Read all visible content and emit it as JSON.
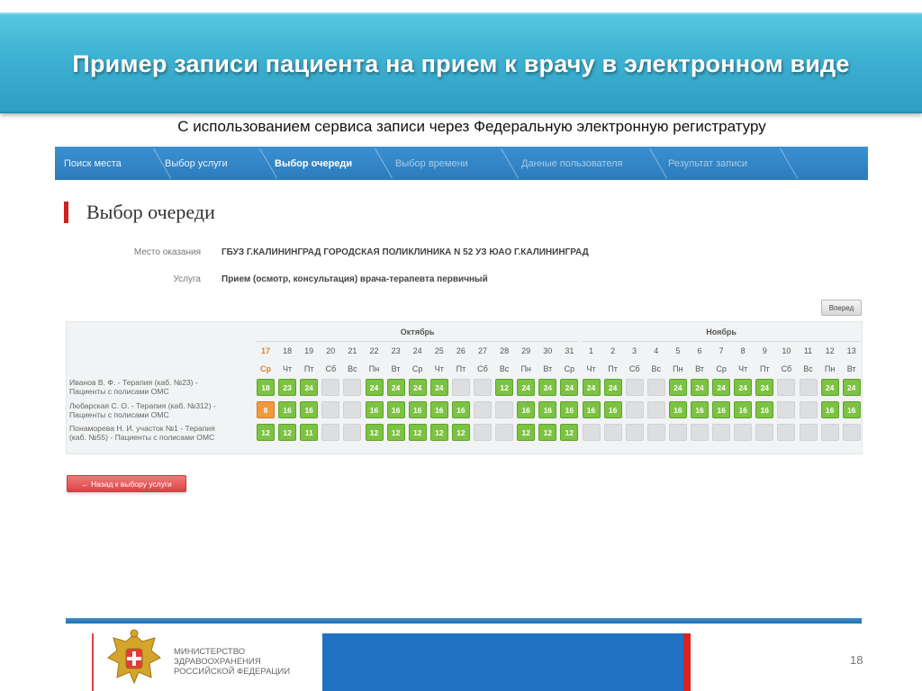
{
  "slide": {
    "title": "Пример записи пациента на прием к врачу в электронном виде",
    "subtitle": "С использованием сервиса записи через Федеральную электронную регистратуру",
    "page_number": "18",
    "ministry": [
      "МИНИСТЕРСТВО",
      "ЗДРАВООХРАНЕНИЯ",
      "РОССИЙСКОЙ ФЕДЕРАЦИИ"
    ],
    "colors": {
      "banner": "#3fb3d3",
      "steps": "#2f80c0",
      "slot_available": "#7cc243",
      "slot_today": "#ef9a3c",
      "slot_empty": "#dcdedf"
    }
  },
  "steps": [
    {
      "label": "Поиск места",
      "state": "done"
    },
    {
      "label": "Выбор услуги",
      "state": "done"
    },
    {
      "label": "Выбор очереди",
      "state": "active"
    },
    {
      "label": "Выбор времени",
      "state": "pending"
    },
    {
      "label": "Данные пользователя",
      "state": "pending"
    },
    {
      "label": "Результат записи",
      "state": "pending"
    }
  ],
  "page": {
    "heading": "Выбор очереди",
    "place_label": "Место оказания",
    "place_value": "ГБУЗ Г.КАЛИНИНГРАД ГОРОДСКАЯ ПОЛИКЛИНИКА N 52 УЗ ЮАО Г.КАЛИНИНГРАД",
    "service_label": "Услуга",
    "service_value": "Прием (осмотр, консультация) врача-терапевта первичный",
    "next_button": "Вперед",
    "back_button": "← Назад к выбору услуги"
  },
  "schedule": {
    "months": [
      {
        "name": "Октябрь",
        "start": 0,
        "end": 14
      },
      {
        "name": "Ноябрь",
        "start": 15,
        "end": 27
      }
    ],
    "days": [
      {
        "num": "17",
        "dow": "Ср",
        "today": true
      },
      {
        "num": "18",
        "dow": "Чт"
      },
      {
        "num": "19",
        "dow": "Пт"
      },
      {
        "num": "20",
        "dow": "Сб"
      },
      {
        "num": "21",
        "dow": "Вс"
      },
      {
        "num": "22",
        "dow": "Пн"
      },
      {
        "num": "23",
        "dow": "Вт"
      },
      {
        "num": "24",
        "dow": "Ср"
      },
      {
        "num": "25",
        "dow": "Чт"
      },
      {
        "num": "26",
        "dow": "Пт"
      },
      {
        "num": "27",
        "dow": "Сб"
      },
      {
        "num": "28",
        "dow": "Вс"
      },
      {
        "num": "29",
        "dow": "Пн"
      },
      {
        "num": "30",
        "dow": "Вт"
      },
      {
        "num": "31",
        "dow": "Ср"
      },
      {
        "num": "1",
        "dow": "Чт"
      },
      {
        "num": "2",
        "dow": "Пт"
      },
      {
        "num": "3",
        "dow": "Сб"
      },
      {
        "num": "4",
        "dow": "Вс"
      },
      {
        "num": "5",
        "dow": "Пн"
      },
      {
        "num": "6",
        "dow": "Вт"
      },
      {
        "num": "7",
        "dow": "Ср"
      },
      {
        "num": "8",
        "dow": "Чт"
      },
      {
        "num": "9",
        "dow": "Пт"
      },
      {
        "num": "10",
        "dow": "Сб"
      },
      {
        "num": "11",
        "dow": "Вс"
      },
      {
        "num": "12",
        "dow": "Пн"
      },
      {
        "num": "13",
        "dow": "Вт"
      }
    ],
    "rows": [
      {
        "label": [
          "Иванов В. Ф. - Терапия (каб. №23) -",
          "Пациенты с полисами ОМС"
        ],
        "slots": [
          "18",
          "23",
          "24",
          "",
          "",
          "24",
          "24",
          "24",
          "24",
          "",
          "",
          "12",
          "24",
          "24",
          "24",
          "24",
          "24",
          "",
          "",
          "24",
          "24",
          "24",
          "24",
          "24",
          "",
          "",
          "24",
          "24"
        ]
      },
      {
        "label": [
          "Любарская С. О. - Терапия (каб. №312) -",
          "Пациенты с полисами ОМС"
        ],
        "slots": [
          "8",
          "16",
          "16",
          "",
          "",
          "16",
          "16",
          "16",
          "16",
          "16",
          "",
          "",
          "16",
          "16",
          "16",
          "16",
          "16",
          "",
          "",
          "16",
          "16",
          "16",
          "16",
          "16",
          "",
          "",
          "16",
          "16"
        ]
      },
      {
        "label": [
          "Понаморева Н. И. участок №1 - Терапия",
          "(каб. №55) - Пациенты с полисами ОМС"
        ],
        "slots": [
          "12",
          "12",
          "11",
          "",
          "",
          "12",
          "12",
          "12",
          "12",
          "12",
          "",
          "",
          "12",
          "12",
          "12",
          "",
          "",
          "",
          "",
          "",
          "",
          "",
          "",
          "",
          "",
          "",
          "",
          ""
        ]
      }
    ]
  }
}
